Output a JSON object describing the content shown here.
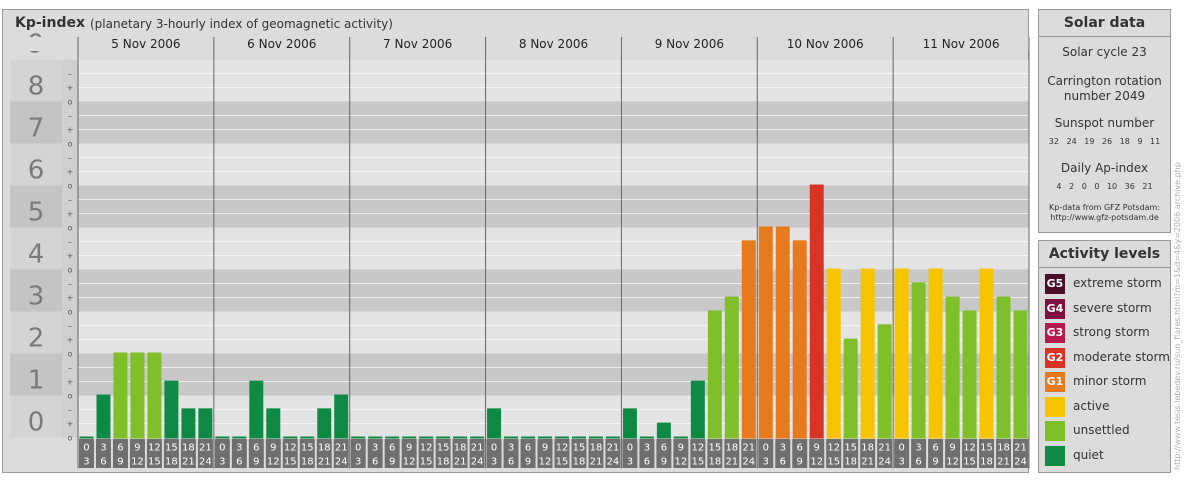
{
  "header": {
    "title": "Kp-index",
    "subtitle": "(planetary 3-hourly index of geomagnetic activity)"
  },
  "chart_data": {
    "type": "bar",
    "title": "Kp-index",
    "subtitle": "(planetary 3-hourly index of geomagnetic activity)",
    "ylim": [
      0,
      9
    ],
    "y_ticks": [
      "0",
      "1",
      "2",
      "3",
      "4",
      "5",
      "6",
      "7",
      "8",
      "9"
    ],
    "y_minor_ticks": [
      "o",
      "+",
      "–"
    ],
    "days": [
      "5 Nov 2006",
      "6 Nov 2006",
      "7 Nov 2006",
      "8 Nov 2006",
      "9 Nov 2006",
      "10 Nov 2006",
      "11 Nov 2006"
    ],
    "interval_starts": [
      "0",
      "3",
      "6",
      "9",
      "12",
      "15",
      "18",
      "21"
    ],
    "interval_ends": [
      "3",
      "6",
      "9",
      "12",
      "15",
      "18",
      "21",
      "24"
    ],
    "series": [
      {
        "day": "5 Nov 2006",
        "values": [
          0,
          1,
          2,
          2,
          2,
          1.33,
          0.67,
          0.67
        ]
      },
      {
        "day": "6 Nov 2006",
        "values": [
          0,
          0,
          1.33,
          0.67,
          0,
          0,
          0.67,
          1
        ]
      },
      {
        "day": "7 Nov 2006",
        "values": [
          0,
          0,
          0,
          0,
          0,
          0,
          0,
          0
        ]
      },
      {
        "day": "8 Nov 2006",
        "values": [
          0.67,
          0,
          0,
          0,
          0,
          0,
          0,
          0
        ]
      },
      {
        "day": "9 Nov 2006",
        "values": [
          0.67,
          0,
          0.33,
          0,
          1.33,
          3,
          3.33,
          4.67
        ]
      },
      {
        "day": "10 Nov 2006",
        "values": [
          5,
          5,
          4.67,
          6,
          4,
          2.33,
          4,
          2.67
        ]
      },
      {
        "day": "11 Nov 2006",
        "values": [
          4,
          3.67,
          4,
          3.33,
          3,
          4,
          3.33,
          3
        ]
      }
    ],
    "color_rule": [
      {
        "min": 0,
        "color": "#0f8a45"
      },
      {
        "min": 2,
        "color": "#7fbf2a"
      },
      {
        "min": 4,
        "color": "#f7c500"
      },
      {
        "min": 4.67,
        "color": "#e87a1e"
      },
      {
        "min": 6,
        "color": "#d93325"
      }
    ],
    "grid": true
  },
  "solar": {
    "title": "Solar data",
    "cycle": "Solar cycle 23",
    "carrington_line1": "Carrington rotation",
    "carrington_line2": "number 2049",
    "sunspot_label": "Sunspot number",
    "sunspot_values": "32 24 19 26 18 9 11",
    "ap_label": "Daily Ap-index",
    "ap_values": "4 2 0 0 10 36 21",
    "credit_line1": "Kp-data from GFZ Potsdam:",
    "credit_line2": "http://www.gfz-potsdam.de"
  },
  "levels": {
    "title": "Activity levels",
    "items": [
      {
        "badge": "G5",
        "label": "extreme storm",
        "color": "#4a0f26"
      },
      {
        "badge": "G4",
        "label": "severe storm",
        "color": "#7d1240"
      },
      {
        "badge": "G3",
        "label": "strong storm",
        "color": "#b51a4d"
      },
      {
        "badge": "G2",
        "label": "moderate storm",
        "color": "#d93325"
      },
      {
        "badge": "G1",
        "label": "minor storm",
        "color": "#e87a1e"
      },
      {
        "badge": "",
        "label": "active",
        "color": "#f7c500"
      },
      {
        "badge": "",
        "label": "unsettled",
        "color": "#7fbf2a"
      },
      {
        "badge": "",
        "label": "quiet",
        "color": "#0f8a45"
      }
    ]
  },
  "credit_vertical": "http://www.tesis.lebedev.ru/sun_flares.html?m=1&d=4&y=2006 archive.php"
}
